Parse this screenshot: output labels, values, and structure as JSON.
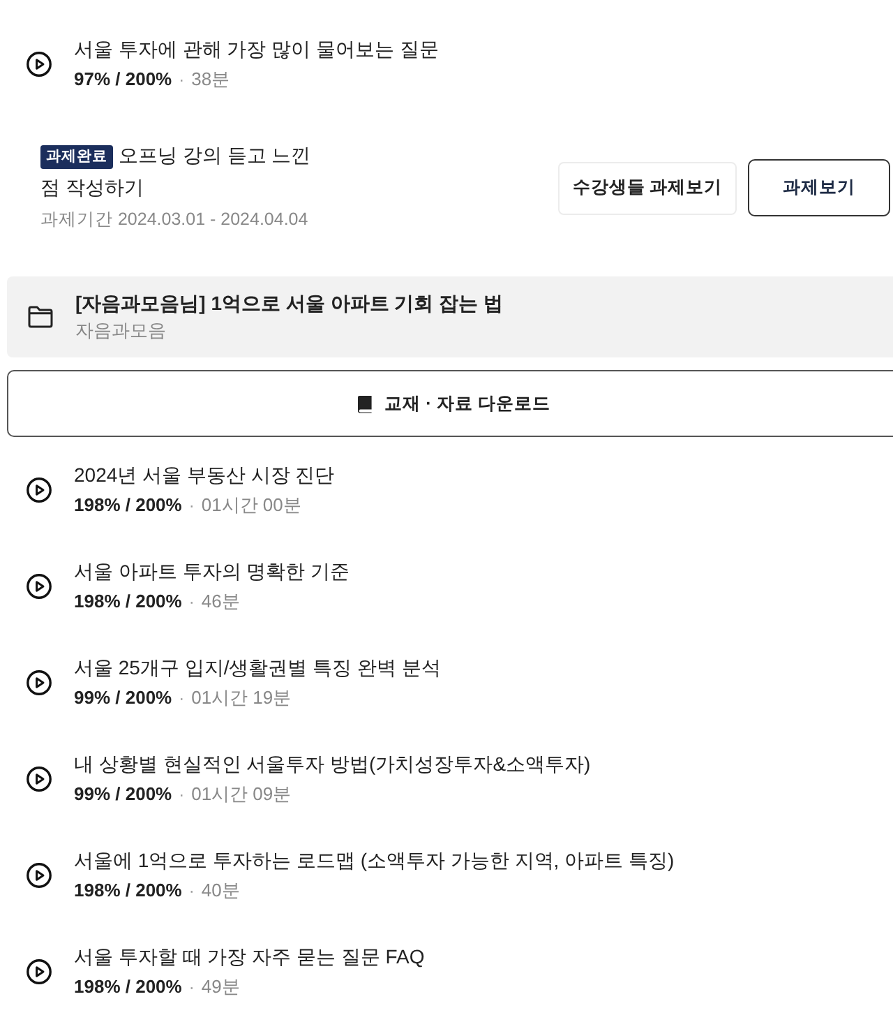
{
  "items": [
    {
      "kind": "lesson",
      "title": "서울 투자에 관해 가장 많이 물어보는 질문",
      "progress": "97% / 200%",
      "separator": "·",
      "duration": "38분"
    },
    {
      "kind": "assignment",
      "badge": "과제완료",
      "title": "오프닝 강의 듣고 느낀 점 작성하기",
      "period": "과제기간 2024.03.01 - 2024.04.04",
      "buttons": [
        {
          "kind": "light",
          "label": "수강생들 과제보기"
        },
        {
          "kind": "outline",
          "label": "과제보기"
        }
      ]
    },
    {
      "kind": "section",
      "title": "[자음과모음님] 1억으로 서울 아파트 기회 잡는 법",
      "subtitle": "자음과모음"
    },
    {
      "kind": "download",
      "label": "교재 · 자료 다운로드"
    },
    {
      "kind": "lesson",
      "title": "2024년 서울 부동산 시장 진단",
      "progress": "198% / 200%",
      "separator": "·",
      "duration": "01시간 00분"
    },
    {
      "kind": "lesson",
      "title": "서울 아파트 투자의 명확한 기준",
      "progress": "198% / 200%",
      "separator": "·",
      "duration": "46분"
    },
    {
      "kind": "lesson",
      "title": "서울 25개구 입지/생활권별 특징 완벽 분석",
      "progress": "99% / 200%",
      "separator": "·",
      "duration": "01시간 19분"
    },
    {
      "kind": "lesson",
      "title": "내 상황별 현실적인 서울투자 방법(가치성장투자&소액투자)",
      "progress": "99% / 200%",
      "separator": "·",
      "duration": "01시간 09분"
    },
    {
      "kind": "lesson",
      "title": "서울에 1억으로 투자하는 로드맵 (소액투자 가능한 지역, 아파트 특징)",
      "progress": "198% / 200%",
      "separator": "·",
      "duration": "40분"
    },
    {
      "kind": "lesson",
      "title": "서울 투자할 때 가장 자주 묻는 질문 FAQ",
      "progress": "198% / 200%",
      "separator": "·",
      "duration": "49분"
    }
  ]
}
